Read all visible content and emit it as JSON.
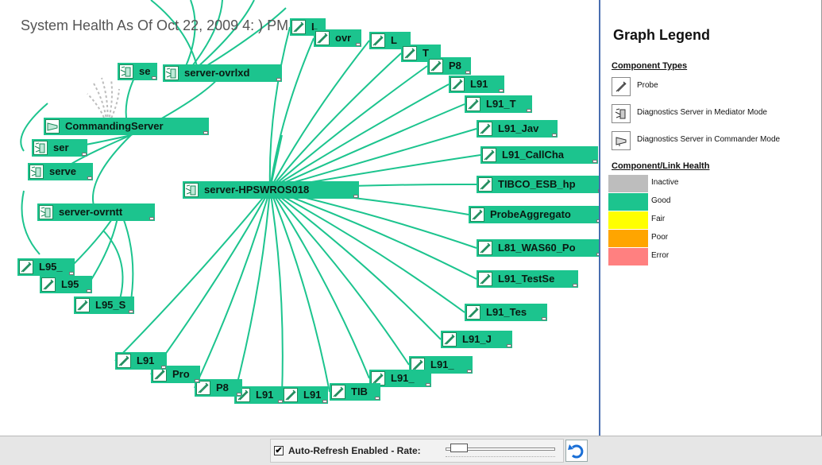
{
  "graph": {
    "title": "System Health As Of Oct 22, 2009 4:  ) PM PDT",
    "edge_color": "#1cc48e",
    "inactive_color": "#bdbdbd",
    "nodes": [
      {
        "label": "server-HPSWROS018",
        "type": "mediator"
      },
      {
        "label": "CommandingServer",
        "type": "commander"
      },
      {
        "label": "server-ovrlxd",
        "type": "mediator"
      },
      {
        "label": "server-ovrntt",
        "type": "mediator"
      },
      {
        "label": "se",
        "type": "mediator"
      },
      {
        "label": "ser",
        "type": "mediator"
      },
      {
        "label": "serve",
        "type": "mediator"
      },
      {
        "label": "L",
        "type": "probe"
      },
      {
        "label": "ovr",
        "type": "probe"
      },
      {
        "label": "L",
        "type": "probe"
      },
      {
        "label": "T",
        "type": "probe"
      },
      {
        "label": "P8",
        "type": "probe"
      },
      {
        "label": "L91",
        "type": "probe"
      },
      {
        "label": "L91_T",
        "type": "probe"
      },
      {
        "label": "L91_Jav",
        "type": "probe"
      },
      {
        "label": "L91_CallCha",
        "type": "probe"
      },
      {
        "label": "TIBCO_ESB_hp",
        "type": "probe"
      },
      {
        "label": "ProbeAggregato",
        "type": "probe"
      },
      {
        "label": "L81_WAS60_Po",
        "type": "probe"
      },
      {
        "label": "L91_TestSe",
        "type": "probe"
      },
      {
        "label": "L91_Tes",
        "type": "probe"
      },
      {
        "label": "L91_J",
        "type": "probe"
      },
      {
        "label": "L91_",
        "type": "probe"
      },
      {
        "label": "L91_",
        "type": "probe"
      },
      {
        "label": "TIB",
        "type": "probe"
      },
      {
        "label": "L91",
        "type": "probe"
      },
      {
        "label": "L91",
        "type": "probe"
      },
      {
        "label": "P8",
        "type": "probe"
      },
      {
        "label": "Pro",
        "type": "probe"
      },
      {
        "label": "L91",
        "type": "probe"
      },
      {
        "label": "L95_",
        "type": "probe"
      },
      {
        "label": "L95",
        "type": "probe"
      },
      {
        "label": "L95_S",
        "type": "probe"
      }
    ]
  },
  "legend": {
    "title": "Graph Legend",
    "component_types_heading": "Component Types",
    "types": [
      {
        "label": "Probe",
        "icon": "probe-icon"
      },
      {
        "label": "Diagnostics Server in Mediator Mode",
        "icon": "mediator-server-icon"
      },
      {
        "label": "Diagnostics Server in Commander Mode",
        "icon": "commander-server-icon"
      }
    ],
    "health_heading": "Component/Link Health",
    "health": [
      {
        "label": "Inactive",
        "color": "#bdbdbd"
      },
      {
        "label": "Good",
        "color": "#1cc48e"
      },
      {
        "label": "Fair",
        "color": "#ffff00"
      },
      {
        "label": "Poor",
        "color": "#ffa500"
      },
      {
        "label": "Error",
        "color": "#ff8080"
      }
    ]
  },
  "bottom": {
    "checkbox_checked": true,
    "checkbox_mark": "✔",
    "auto_refresh_label": "Auto-Refresh Enabled - Rate:",
    "refresh_icon": "refresh-icon"
  }
}
